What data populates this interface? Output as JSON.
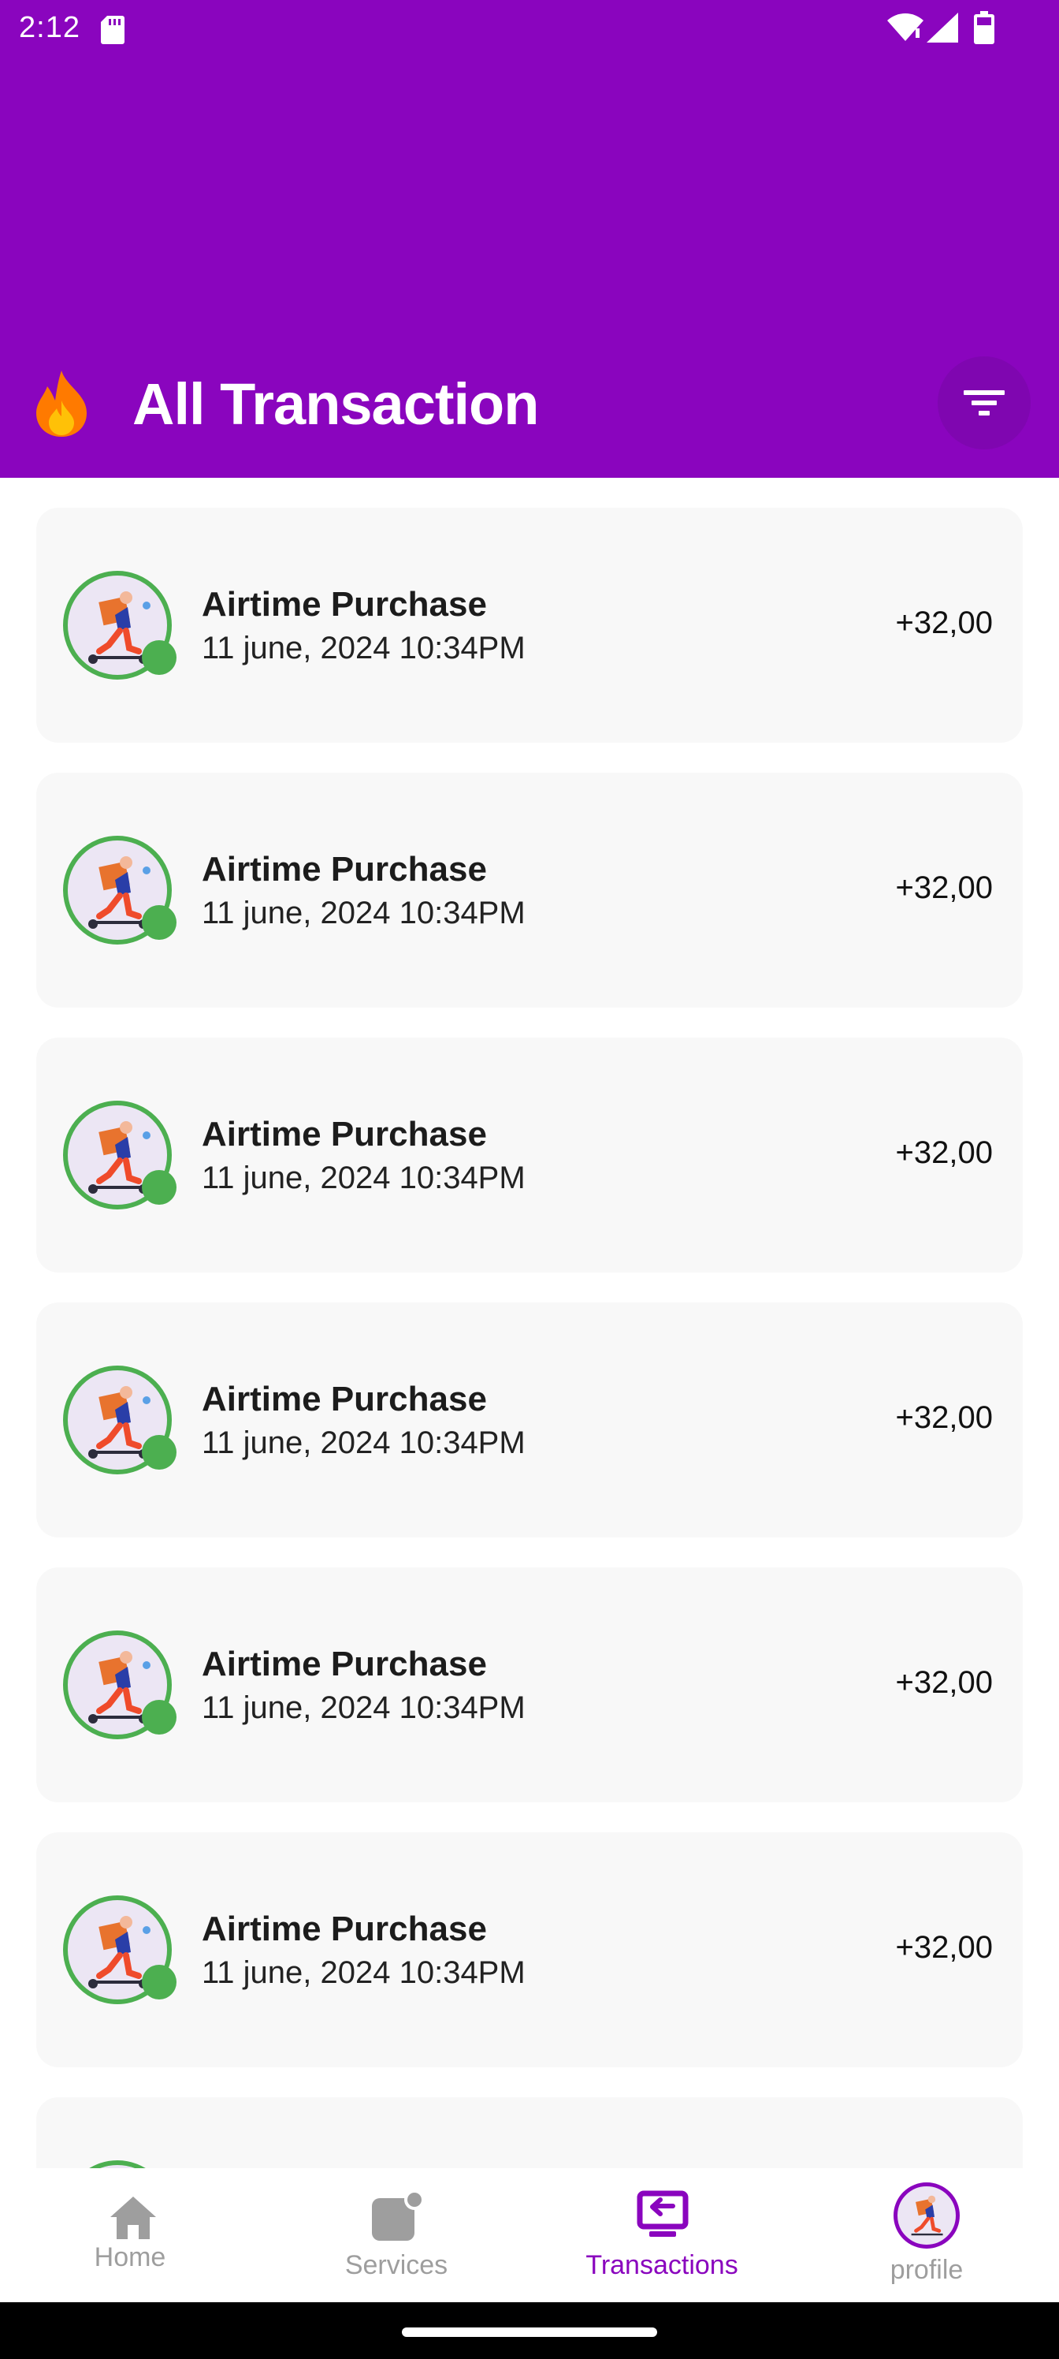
{
  "status_bar": {
    "time": "2:12",
    "icons": [
      "sd-card-icon",
      "wifi-icon",
      "signal-icon",
      "battery-icon"
    ]
  },
  "header": {
    "title": "All Transaction",
    "leading_icon": "fire-icon",
    "action_icon": "filter-icon",
    "background": "#8a05be"
  },
  "transactions": [
    {
      "title": "Airtime Purchase",
      "date": "11 june, 2024 10:34PM",
      "amount": "+32,00"
    },
    {
      "title": "Airtime Purchase",
      "date": "11 june, 2024 10:34PM",
      "amount": "+32,00"
    },
    {
      "title": "Airtime Purchase",
      "date": "11 june, 2024 10:34PM",
      "amount": "+32,00"
    },
    {
      "title": "Airtime Purchase",
      "date": "11 june, 2024 10:34PM",
      "amount": "+32,00"
    },
    {
      "title": "Airtime Purchase",
      "date": "11 june, 2024 10:34PM",
      "amount": "+32,00"
    },
    {
      "title": "Airtime Purchase",
      "date": "11 june, 2024 10:34PM",
      "amount": "+32,00"
    }
  ],
  "bottom_nav": {
    "items": [
      {
        "label": "Home",
        "icon": "home-icon",
        "active": false
      },
      {
        "label": "Services",
        "icon": "services-icon",
        "active": false
      },
      {
        "label": "Transactions",
        "icon": "transactions-icon",
        "active": true
      },
      {
        "label": "profile",
        "icon": "avatar",
        "active": false
      }
    ]
  },
  "colors": {
    "accent": "#8a05be",
    "status_green": "#4caf50",
    "card_bg": "#f8f8f8",
    "inactive_nav": "#9e9e9e"
  }
}
